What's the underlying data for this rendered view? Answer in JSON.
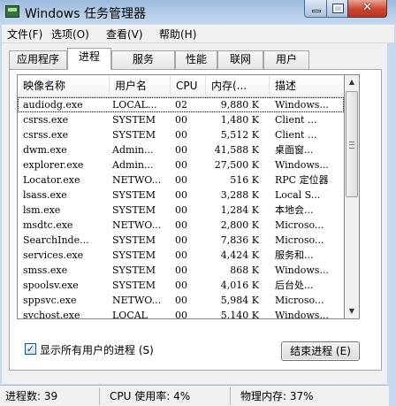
{
  "window": {
    "title": "Windows 任务管理器"
  },
  "menu": [
    "文件(F)",
    "选项(O)",
    "查看(V)",
    "帮助(H)"
  ],
  "tabs": [
    "应用程序",
    "进程",
    "服务",
    "性能",
    "联网",
    "用户"
  ],
  "active_tab": "进程",
  "columns": [
    "映像名称",
    "用户名",
    "CPU",
    "内存(...",
    "描述"
  ],
  "processes": [
    {
      "name": "audiodg.exe",
      "user": "LOCAL...",
      "cpu": "02",
      "mem": "9,880 K",
      "desc": "Windows..."
    },
    {
      "name": "csrss.exe",
      "user": "SYSTEM",
      "cpu": "00",
      "mem": "1,480 K",
      "desc": "Client ..."
    },
    {
      "name": "csrss.exe",
      "user": "SYSTEM",
      "cpu": "00",
      "mem": "5,512 K",
      "desc": "Client ..."
    },
    {
      "name": "dwm.exe",
      "user": "Admin...",
      "cpu": "00",
      "mem": "41,588 K",
      "desc": "桌面窗..."
    },
    {
      "name": "explorer.exe",
      "user": "Admin...",
      "cpu": "00",
      "mem": "27,500 K",
      "desc": "Windows..."
    },
    {
      "name": "Locator.exe",
      "user": "NETWO...",
      "cpu": "00",
      "mem": "516 K",
      "desc": "RPC 定位器"
    },
    {
      "name": "lsass.exe",
      "user": "SYSTEM",
      "cpu": "00",
      "mem": "3,288 K",
      "desc": "Local S..."
    },
    {
      "name": "lsm.exe",
      "user": "SYSTEM",
      "cpu": "00",
      "mem": "1,284 K",
      "desc": "本地会..."
    },
    {
      "name": "msdtc.exe",
      "user": "NETWO...",
      "cpu": "00",
      "mem": "2,800 K",
      "desc": "Microso..."
    },
    {
      "name": "SearchInde...",
      "user": "SYSTEM",
      "cpu": "00",
      "mem": "7,836 K",
      "desc": "Microso..."
    },
    {
      "name": "services.exe",
      "user": "SYSTEM",
      "cpu": "00",
      "mem": "4,424 K",
      "desc": "服务和..."
    },
    {
      "name": "smss.exe",
      "user": "SYSTEM",
      "cpu": "00",
      "mem": "868 K",
      "desc": "Windows..."
    },
    {
      "name": "spoolsv.exe",
      "user": "SYSTEM",
      "cpu": "00",
      "mem": "4,016 K",
      "desc": "后台处..."
    },
    {
      "name": "sppsvc.exe",
      "user": "NETWO...",
      "cpu": "00",
      "mem": "5,984 K",
      "desc": "Microso..."
    },
    {
      "name": "svchost.exe",
      "user": "LOCAL",
      "cpu": "00",
      "mem": "5,140 K",
      "desc": "Windows..."
    }
  ],
  "selected_row": 0,
  "show_all_users": {
    "label": "显示所有用户的进程 (S)",
    "checked": true
  },
  "end_process_label": "结束进程 (E)",
  "status": {
    "processes": "进程数: 39",
    "cpu": "CPU 使用率: 4%",
    "memory": "物理内存: 37%"
  }
}
